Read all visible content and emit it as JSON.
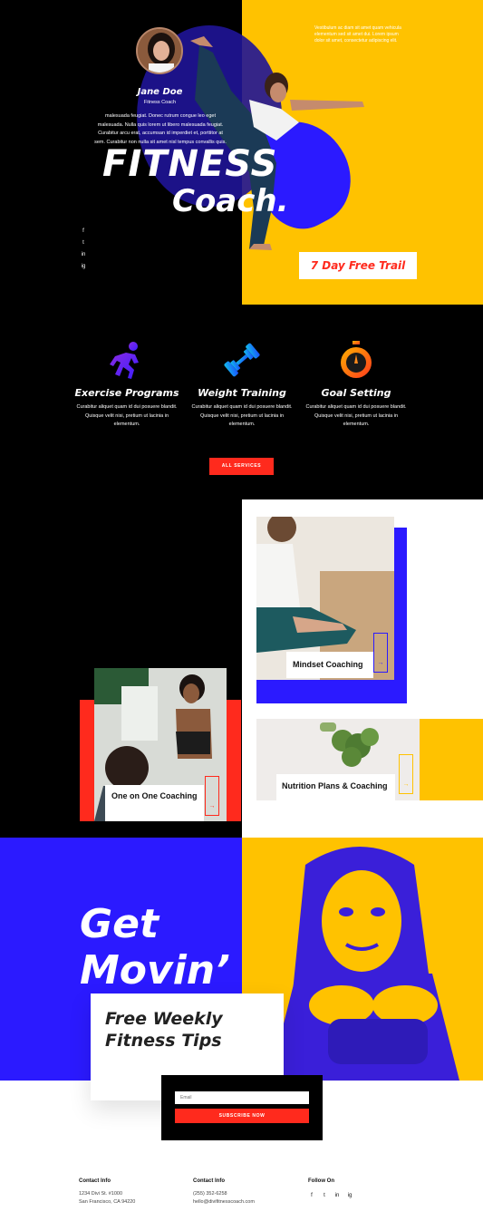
{
  "hero": {
    "blurb": "Vestibulum ac diam sit amet quam vehicula elementum sed sit amet dui. Lorem ipsum dolor sit amet, consectetur adipiscing elit.",
    "title": "FITNESS",
    "subtitle": "Coach.",
    "cta": "7 Day Free Trail",
    "social": [
      "f",
      "t",
      "in",
      "ig"
    ],
    "social_icons": [
      "facebook-icon",
      "twitter-icon",
      "linkedin-icon",
      "instagram-icon"
    ]
  },
  "services": {
    "items": [
      {
        "icon": "running-person-icon",
        "title": "Exercise Programs",
        "text": "Curabitur aliquet quam id dui posuere blandit. Quisque velit nisi, pretium ut lacinia in elementum."
      },
      {
        "icon": "dumbbell-icon",
        "title": "Weight Training",
        "text": "Curabitur aliquet quam id dui posuere blandit. Quisque velit nisi, pretium ut lacinia in elementum."
      },
      {
        "icon": "stopwatch-icon",
        "title": "Goal Setting",
        "text": "Curabitur aliquet quam id dui posuere blandit. Quisque velit nisi, pretium ut lacinia in elementum."
      }
    ],
    "button": "ALL SERVICES"
  },
  "coach": {
    "name": "Jane Doe",
    "role": "Fitness Coach",
    "bio": "malesuada feugiat. Donec rutrum congue leo eget malesuada. Nulla quis lorem ut libero malesuada feugiat. Curabitur arcu erat, accumsan id imperdiet et, porttitor at sem. Curabitur non nulla sit amet nisl tempus convallis quis."
  },
  "cards": [
    {
      "label": "Mindset Coaching",
      "arrow": "→"
    },
    {
      "label": "Nutrition Plans & Coaching",
      "arrow": "→"
    },
    {
      "label": "One on One Coaching",
      "arrow": "→"
    }
  ],
  "newsletter": {
    "title_line1": "Get",
    "title_line2": "Movin’",
    "tips_line1": "Free Weekly",
    "tips_line2": "Fitness Tips",
    "email_placeholder": "Email",
    "button": "SUBSCRIBE NOW"
  },
  "footer": {
    "col1_heading": "Contact Info",
    "col1_line1": "1234 Divi St. #1000",
    "col1_line2": "San Francisco, CA 94220",
    "col2_heading": "Contact Info",
    "col2_line1": "(255) 352-6258",
    "col2_line2": "hello@divifitnesscoach.com",
    "col3_heading": "Follow On",
    "social": [
      "f",
      "t",
      "in",
      "ig"
    ]
  },
  "colors": {
    "black": "#000000",
    "yellow": "#ffc200",
    "blue": "#2b1aff",
    "red": "#ff2a1d",
    "white": "#ffffff"
  }
}
